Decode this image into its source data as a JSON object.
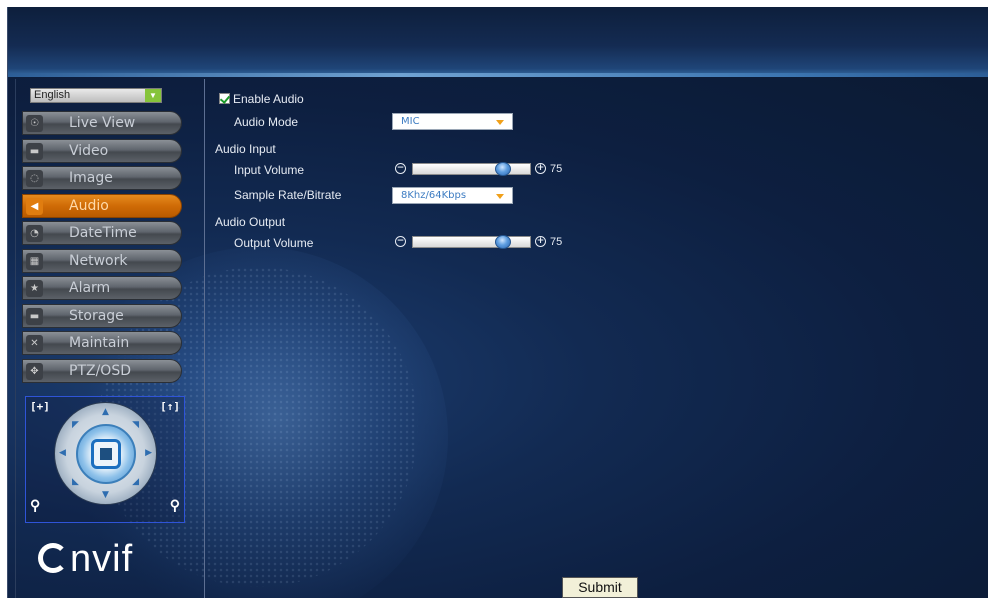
{
  "language": {
    "selected": "English"
  },
  "sidebar": {
    "items": [
      {
        "label": "Live View",
        "icon": "chat-bubble-icon",
        "glyph": "☉"
      },
      {
        "label": "Video",
        "icon": "camera-icon",
        "glyph": "▬"
      },
      {
        "label": "Image",
        "icon": "image-icon",
        "glyph": "◌"
      },
      {
        "label": "Audio",
        "icon": "speaker-icon",
        "glyph": "◀"
      },
      {
        "label": "DateTime",
        "icon": "clock-icon",
        "glyph": "◔"
      },
      {
        "label": "Network",
        "icon": "network-icon",
        "glyph": "▦"
      },
      {
        "label": "Alarm",
        "icon": "star-icon",
        "glyph": "★"
      },
      {
        "label": "Storage",
        "icon": "storage-icon",
        "glyph": "▬"
      },
      {
        "label": "Maintain",
        "icon": "tools-icon",
        "glyph": "✕"
      },
      {
        "label": "PTZ/OSD",
        "icon": "move-icon",
        "glyph": "✥"
      }
    ],
    "active": "Audio"
  },
  "ptz": {
    "iris_label": "[+]",
    "focus_label": "[↑]"
  },
  "brand": {
    "logo_text": "nvif"
  },
  "form": {
    "enable_audio": {
      "label": "Enable Audio",
      "checked": true
    },
    "audio_mode": {
      "label": "Audio Mode",
      "value": "MIC"
    },
    "audio_input": {
      "heading": "Audio Input"
    },
    "input_volume": {
      "label": "Input Volume",
      "value": "75",
      "level": 0.75
    },
    "sample_rate": {
      "label": "Sample Rate/Bitrate",
      "value": "8Khz/64Kbps"
    },
    "audio_output": {
      "heading": "Audio Output"
    },
    "output_volume": {
      "label": "Output Volume",
      "value": "75",
      "level": 0.75
    },
    "submit_label": "Submit"
  },
  "colors": {
    "accent_active": "#d96f08",
    "background": "#0b1a33",
    "check": "#1c9a2a"
  }
}
